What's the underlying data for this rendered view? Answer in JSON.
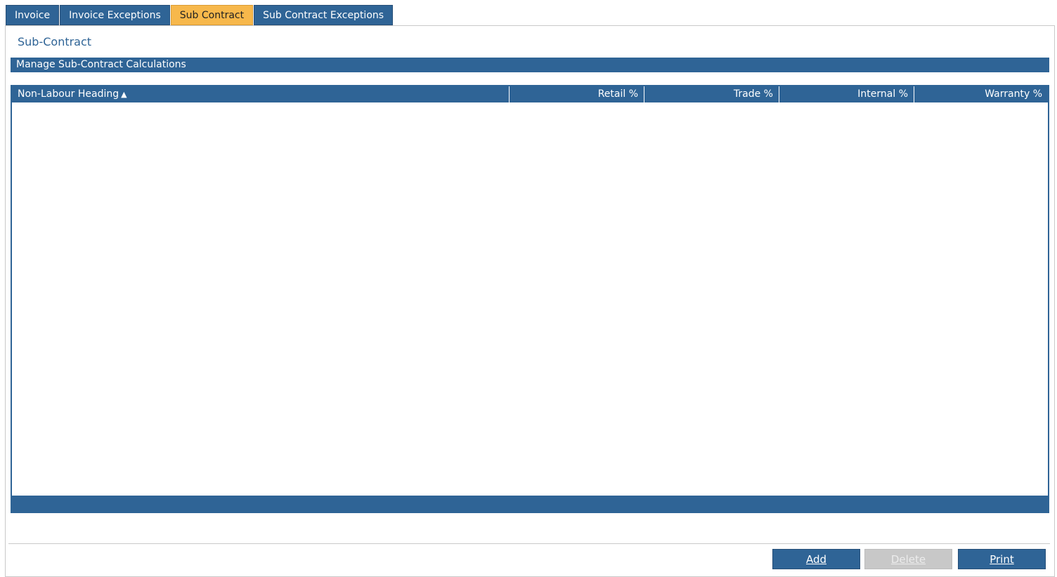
{
  "tabs": [
    {
      "label": "Invoice",
      "active": false
    },
    {
      "label": "Invoice Exceptions",
      "active": false
    },
    {
      "label": "Sub Contract",
      "active": true
    },
    {
      "label": "Sub Contract Exceptions",
      "active": false
    }
  ],
  "page": {
    "title": "Sub-Contract",
    "section_title": "Manage Sub-Contract Calculations"
  },
  "grid": {
    "columns": [
      "Non-Labour Heading",
      "Retail %",
      "Trade %",
      "Internal %",
      "Warranty %"
    ],
    "sort_indicator": "▲",
    "rows": []
  },
  "buttons": {
    "add": "Add",
    "delete": "Delete",
    "print": "Print"
  },
  "colors": {
    "primary": "#2f6496",
    "active_tab": "#f7b84b",
    "disabled": "#c8c8c8"
  }
}
